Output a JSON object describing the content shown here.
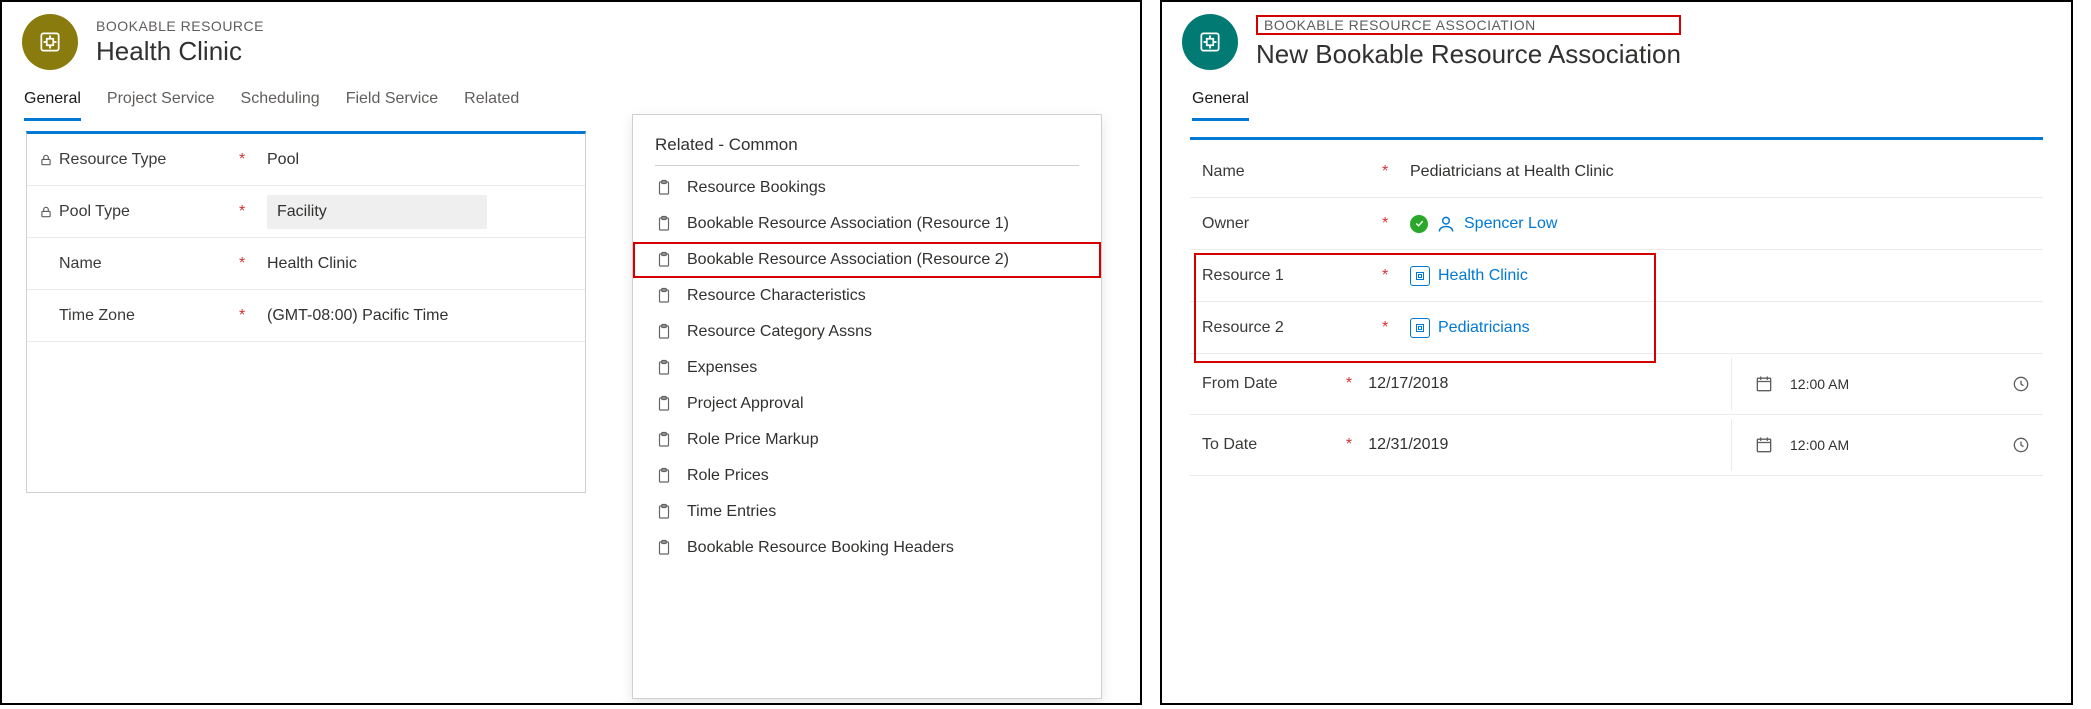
{
  "left": {
    "entity": "BOOKABLE RESOURCE",
    "title": "Health Clinic",
    "tabs": [
      "General",
      "Project Service",
      "Scheduling",
      "Field Service",
      "Related"
    ],
    "active_tab": 0,
    "fields": {
      "resource_type": {
        "label": "Resource Type",
        "value": "Pool",
        "locked": true,
        "required": true
      },
      "pool_type": {
        "label": "Pool Type",
        "value": "Facility",
        "locked": true,
        "required": true
      },
      "name": {
        "label": "Name",
        "value": "Health Clinic",
        "required": true
      },
      "time_zone": {
        "label": "Time Zone",
        "value": "(GMT-08:00) Pacific Time",
        "required": true
      }
    },
    "related": {
      "section": "Related - Common",
      "items": [
        "Resource Bookings",
        "Bookable Resource Association (Resource 1)",
        "Bookable Resource Association (Resource 2)",
        "Resource Characteristics",
        "Resource Category Assns",
        "Expenses",
        "Project Approval",
        "Role Price Markup",
        "Role Prices",
        "Time Entries",
        "Bookable Resource Booking Headers"
      ],
      "highlighted_index": 2
    }
  },
  "right": {
    "entity": "BOOKABLE RESOURCE ASSOCIATION",
    "title": "New Bookable Resource Association",
    "tab": "General",
    "fields": {
      "name": {
        "label": "Name",
        "value": "Pediatricians at Health Clinic",
        "required": true
      },
      "owner": {
        "label": "Owner",
        "value": "Spencer Low",
        "required": true
      },
      "resource1": {
        "label": "Resource 1",
        "value": "Health Clinic",
        "required": true
      },
      "resource2": {
        "label": "Resource 2",
        "value": "Pediatricians",
        "required": true
      },
      "from_date": {
        "label": "From Date",
        "date": "12/17/2018",
        "time": "12:00 AM",
        "required": true
      },
      "to_date": {
        "label": "To Date",
        "date": "12/31/2019",
        "time": "12:00 AM",
        "required": true
      }
    }
  }
}
